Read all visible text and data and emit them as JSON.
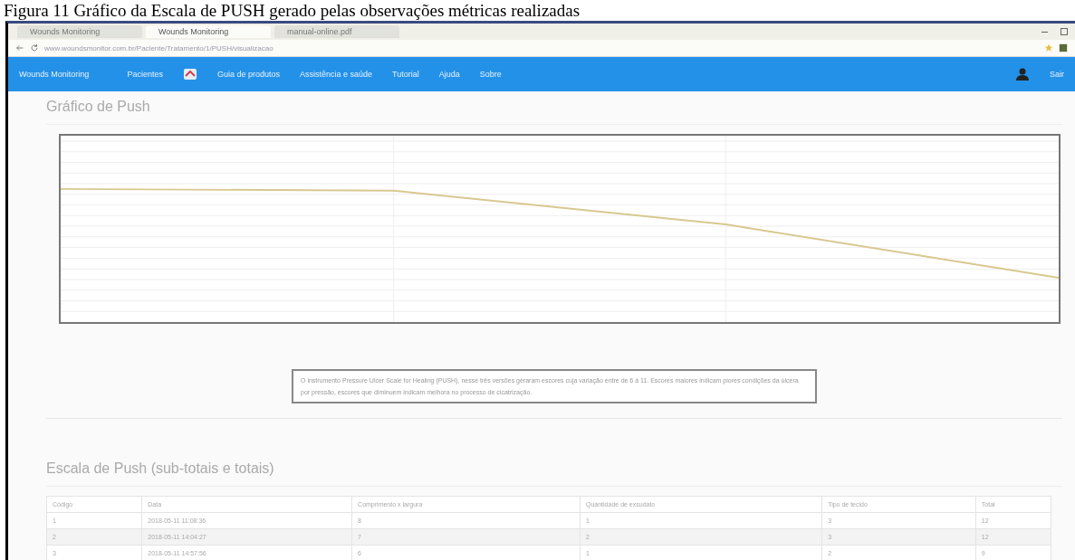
{
  "caption": "Figura 11 Gráfico da Escala de PUSH gerado pelas observações métricas realizadas",
  "browser": {
    "tabs": [
      {
        "label": "Wounds Monitoring",
        "selected": false
      },
      {
        "label": "Wounds Monitoring",
        "selected": true
      },
      {
        "label": "manual-online.pdf",
        "selected": false
      }
    ],
    "url": "www.woundsmonitor.com.br/Paciente/Tratamento/1/PUSH/visualizacao"
  },
  "navbar": {
    "brand": "Wounds Monitoring",
    "items": [
      "Pacientes",
      "Guia de produtos",
      "Assistência e saúde",
      "Tutorial",
      "Ajuda",
      "Sobre"
    ],
    "user": "Sair"
  },
  "chart_section": {
    "title": "Gráfico de Push",
    "note": "O instrumento Pressure Ulcer Scale for Healing (PUSH), nesse três versões geraram escores cuja variação entre de 6 à 11. Escores maiores indicam piores condições da úlcera por pressão, escores que diminuem indicam melhora no processo de cicatrização."
  },
  "table_section": {
    "title": "Escala de Push (sub-totais e totais)",
    "columns": [
      "Código",
      "Data",
      "Comprimento x largura",
      "Quantidade de exsudato",
      "Tipo de tecido",
      "Total"
    ],
    "rows": [
      [
        "1",
        "2018-05-11 11:08:36",
        "8",
        "1",
        "3",
        "12"
      ],
      [
        "2",
        "2018-05-11 14:04:27",
        "7",
        "2",
        "3",
        "12"
      ],
      [
        "3",
        "2018-05-11 14:57:56",
        "6",
        "1",
        "2",
        "9"
      ]
    ]
  }
}
